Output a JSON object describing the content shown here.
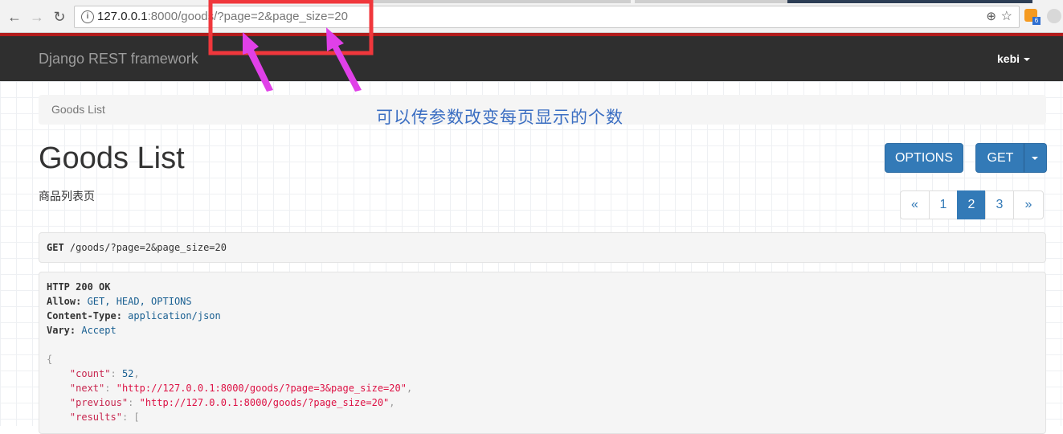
{
  "browser": {
    "url_host": "127.0.0.1",
    "url_rest": ":8000/goods/?page=2&page_size=20",
    "back_icon": "back-arrow-icon",
    "forward_icon": "forward-arrow-icon",
    "reload_icon": "reload-icon",
    "rss_badge": "6"
  },
  "navbar": {
    "brand": "Django REST framework",
    "user": "kebi"
  },
  "breadcrumb": {
    "label": "Goods List"
  },
  "annotation": {
    "text": "可以传参数改变每页显示的个数",
    "color": "#3b6ec2",
    "box_color": "#f0373c",
    "arrow_color": "#e040e8"
  },
  "page": {
    "title": "Goods List",
    "description": "商品列表页"
  },
  "buttons": {
    "options": "OPTIONS",
    "get": "GET"
  },
  "pagination": {
    "prev": "«",
    "pages": [
      "1",
      "2",
      "3"
    ],
    "active": "2",
    "next": "»"
  },
  "request": {
    "method": "GET",
    "path": " /goods/?page=2&page_size=20"
  },
  "response": {
    "status": "HTTP 200 OK",
    "allow_key": "Allow:",
    "allow_val": " GET, HEAD, OPTIONS",
    "ctype_key": "Content-Type:",
    "ctype_val": " application/json",
    "vary_key": "Vary:",
    "vary_val": " Accept",
    "open_brace": "{",
    "count_key": "\"count\"",
    "count_val": "52",
    "next_key": "\"next\"",
    "next_val": "\"http://127.0.0.1:8000/goods/?page=3&page_size=20\"",
    "previous_key": "\"previous\"",
    "previous_val": "\"http://127.0.0.1:8000/goods/?page_size=20\"",
    "results_key": "\"results\"",
    "results_open": "["
  },
  "colors": {
    "navbar_bg": "#2f2f2f",
    "accent_red": "#b21c1c",
    "primary": "#337ab7"
  }
}
